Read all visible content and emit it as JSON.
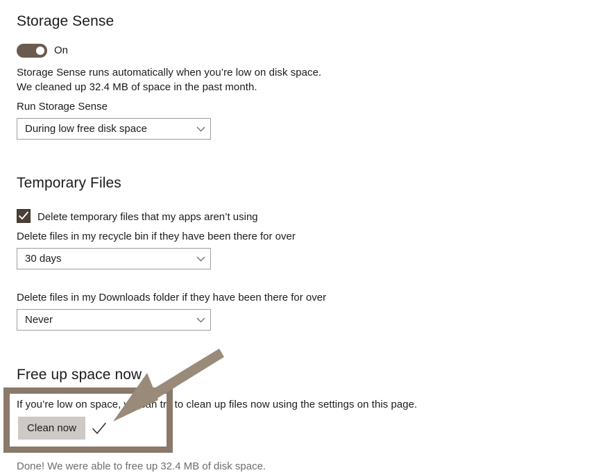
{
  "page": {
    "background": "#ffffff",
    "accent_color": "#6b5a4d",
    "annotation_color": "#8a7a6b"
  },
  "storage_sense": {
    "heading": "Storage Sense",
    "toggle": {
      "state_label": "On",
      "checked": true
    },
    "description_line1": "Storage Sense runs automatically when you’re low on disk space.",
    "description_line2": "We cleaned up 32.4 MB of space in the past month.",
    "run_label": "Run Storage Sense",
    "run_dropdown": {
      "value": "During low free disk space",
      "chevron": "chevron-down-icon"
    }
  },
  "temporary_files": {
    "heading": "Temporary Files",
    "checkbox": {
      "label": "Delete temporary files that my apps aren’t using",
      "checked": true
    },
    "recycle_bin_label": "Delete files in my recycle bin if they have been there for over",
    "recycle_bin_dropdown": {
      "value": "30 days",
      "chevron": "chevron-down-icon"
    },
    "downloads_label": "Delete files in my Downloads folder if they have been there for over",
    "downloads_dropdown": {
      "value": "Never",
      "chevron": "chevron-down-icon"
    }
  },
  "free_up_space": {
    "heading": "Free up space now",
    "description": "If you’re low on space, we can try to clean up files now using the settings on this page.",
    "clean_button_label": "Clean now",
    "success_check": "check-icon",
    "status_text": "Done! We were able to free up 32.4 MB of disk space."
  },
  "annotation": {
    "highlight_box": "highlight-rectangle",
    "arrow": "pointer-arrow"
  }
}
